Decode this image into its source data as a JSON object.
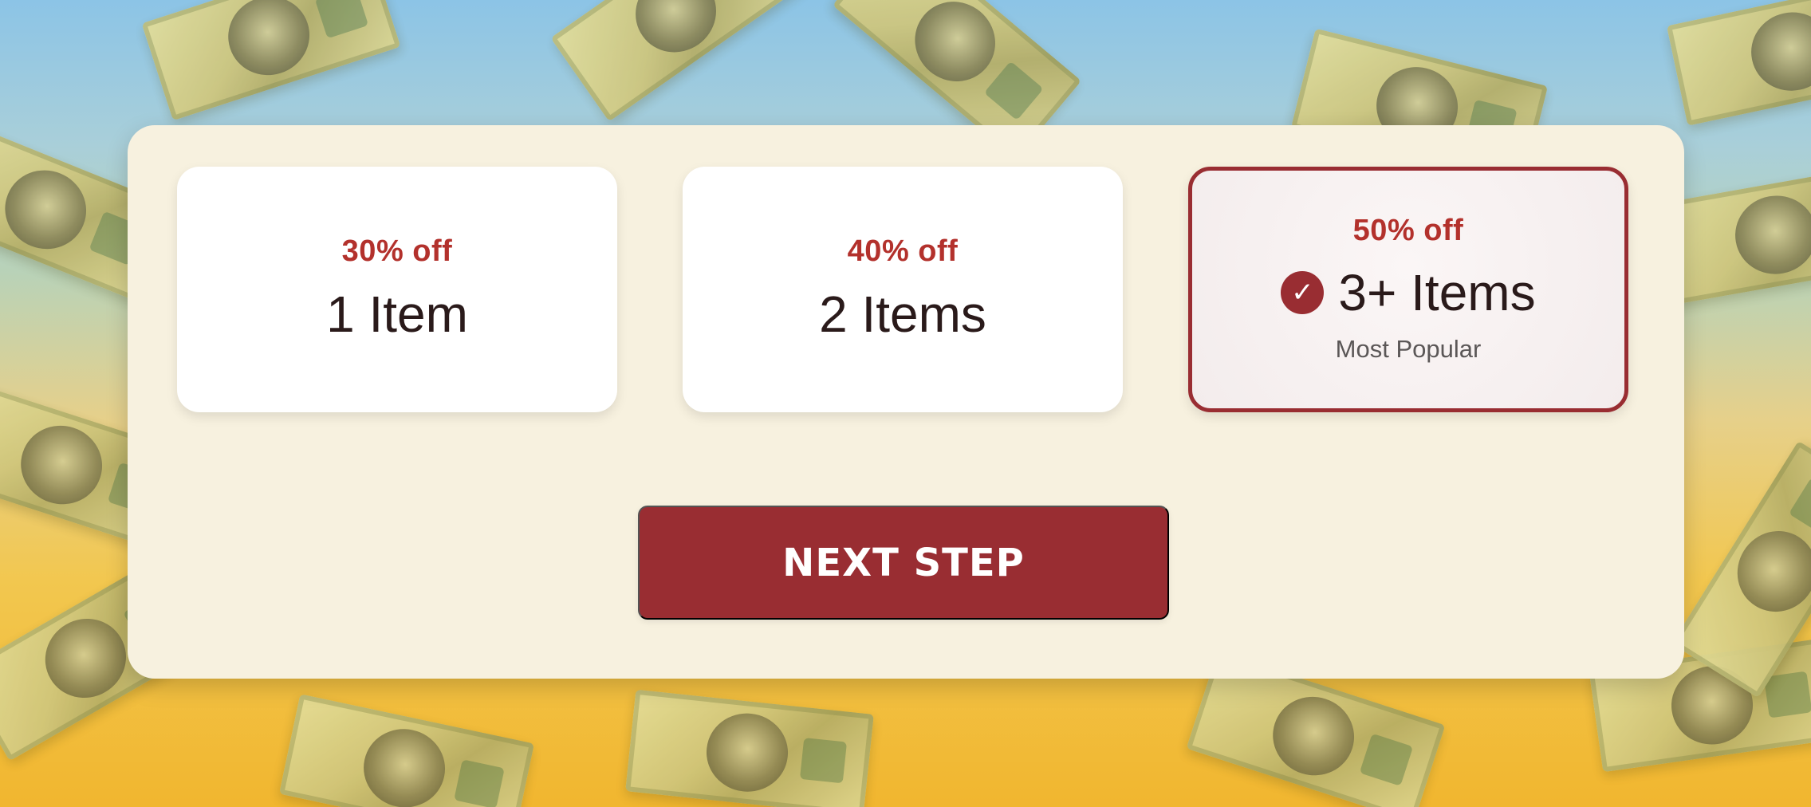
{
  "offers": [
    {
      "discount": "30% off",
      "label": "1 Item"
    },
    {
      "discount": "40% off",
      "label": "2 Items"
    },
    {
      "discount": "50% off",
      "label": "3+ Items",
      "badge": "Most Popular",
      "selected": true,
      "icon": "check-circle-icon"
    }
  ],
  "next_step": {
    "label": "NEXT STEP"
  },
  "colors": {
    "accent": "#992d32",
    "discount_text": "#b3312c",
    "panel_bg": "#f7f1df",
    "card_bg": "#ffffff",
    "dark_text": "#2a1a1a"
  }
}
